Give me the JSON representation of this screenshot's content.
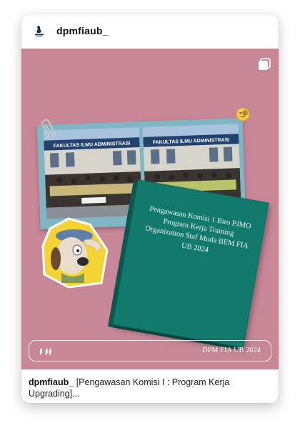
{
  "post": {
    "username": "dpmfiaub_",
    "media": {
      "background_color": "#c78796",
      "book_title": "Pengawasan Komisi 1 Biro PJMO Program Kerja Training Organization Staf Muda BEM FIA UB 2024",
      "building_sign": "FAKULTAS ILMU ADMINISTRASI",
      "footer_text": "DPM FIA UB 2024"
    },
    "caption": {
      "username": "dpmfiaub_",
      "text": "[Pengawasan Komisi I : Program Kerja Upgrading]..."
    },
    "icons": [
      "dpm-logo-icon",
      "multiple-images-icon",
      "paperclip-icon",
      "monocle-face-icon",
      "audio-waveform-icon"
    ]
  }
}
